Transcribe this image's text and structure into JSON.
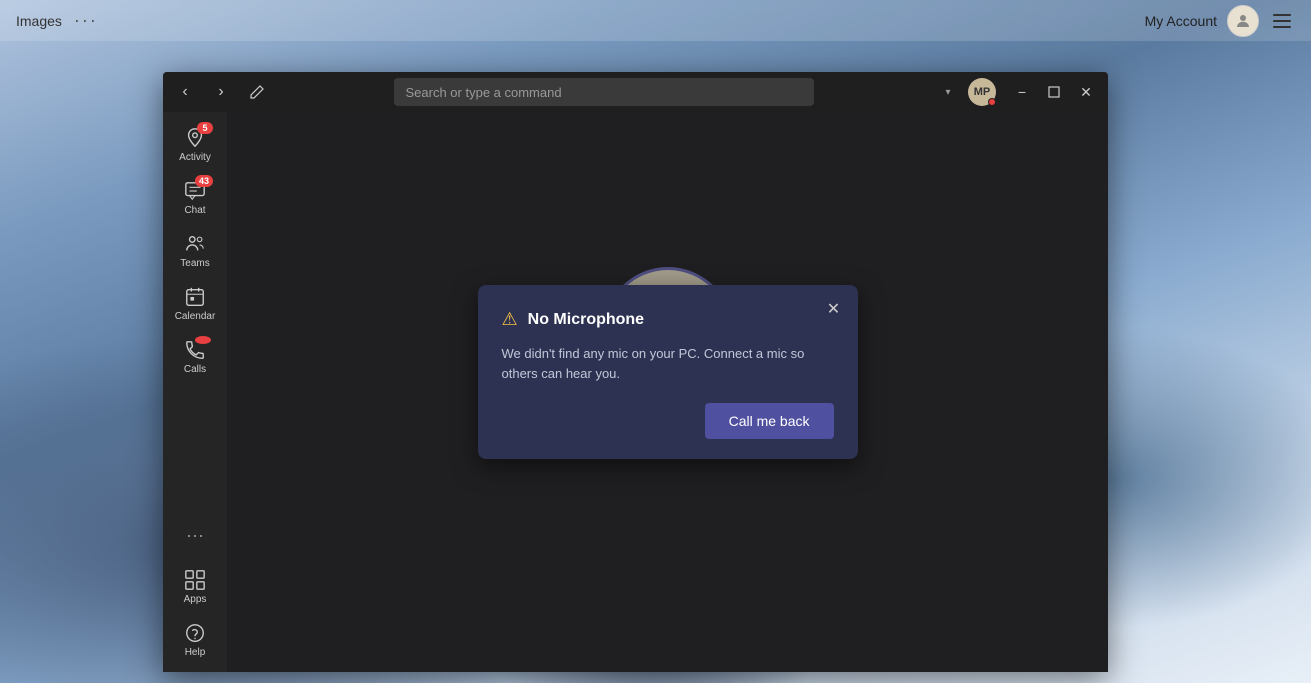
{
  "background": {
    "description": "Winter mountain landscape with snow-covered trees"
  },
  "taskbar": {
    "images_label": "Images",
    "dots_label": "···",
    "my_account_label": "My Account",
    "menu_icon_label": "≡"
  },
  "teams_window": {
    "title_bar": {
      "back_label": "‹",
      "forward_label": "›",
      "edit_label": "✎",
      "search_placeholder": "Search or type a command",
      "avatar_initials": "MP",
      "minimize_label": "−",
      "restore_label": "□",
      "close_label": "✕"
    },
    "sidebar": {
      "items": [
        {
          "id": "activity",
          "label": "Activity",
          "icon": "🔔",
          "badge": "5"
        },
        {
          "id": "chat",
          "label": "Chat",
          "icon": "💬",
          "badge": "43"
        },
        {
          "id": "teams",
          "label": "Teams",
          "icon": "👥",
          "badge": null
        },
        {
          "id": "calendar",
          "label": "Calendar",
          "icon": "📅",
          "badge": null
        },
        {
          "id": "calls",
          "label": "Calls",
          "icon": "📞",
          "badge": null
        }
      ],
      "bottom_items": [
        {
          "id": "more",
          "label": "···",
          "icon": null
        },
        {
          "id": "apps",
          "label": "Apps",
          "icon": "⊞"
        },
        {
          "id": "help",
          "label": "Help",
          "icon": "?"
        }
      ]
    },
    "dialog": {
      "title": "No Microphone",
      "body": "We didn't find any mic on your PC. Connect a mic so others can hear you.",
      "call_back_button": "Call me back",
      "close_label": "✕"
    }
  }
}
